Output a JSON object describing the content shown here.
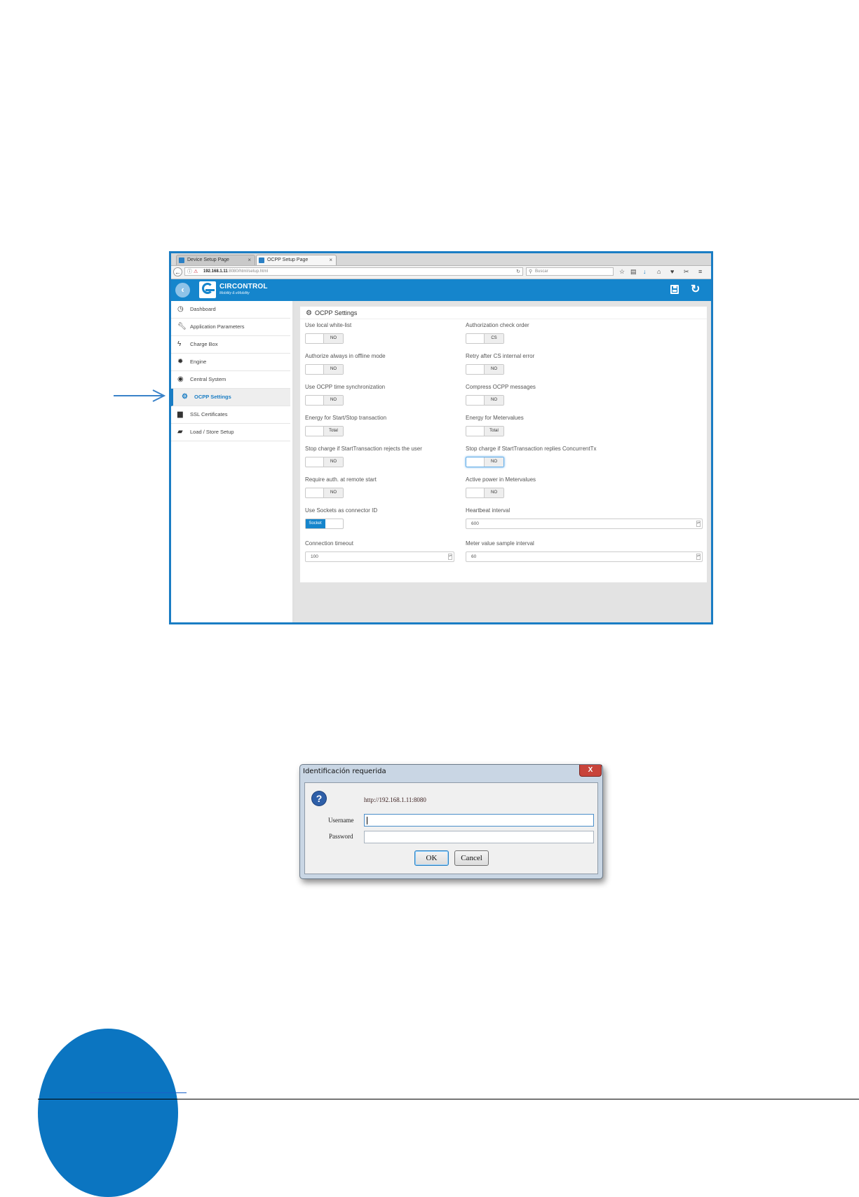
{
  "browser": {
    "tabs": [
      {
        "label": "Device Setup Page",
        "close": "×"
      },
      {
        "label": "OCPP Setup Page",
        "close": "×"
      }
    ],
    "url_host": "192.168.1.11",
    "url_rest": ":8080/html/setup.html",
    "search_placeholder": "Buscar",
    "toolbar_icons": [
      "star-icon",
      "reader-icon",
      "download-icon",
      "home-icon",
      "pocket-icon",
      "extension-icon",
      "menu-icon"
    ]
  },
  "app": {
    "brand": "CIRCONTROL",
    "tagline": "Mobility & eMobility",
    "accent_color": "#1585cc"
  },
  "sidebar": {
    "items": [
      {
        "label": "Dashboard",
        "icon": "dashboard-icon"
      },
      {
        "label": "Application Parameters",
        "icon": "wrench-icon"
      },
      {
        "label": "Charge Box",
        "icon": "bolt-icon"
      },
      {
        "label": "Engine",
        "icon": "engine-icon"
      },
      {
        "label": "Central System",
        "icon": "target-icon"
      },
      {
        "label": "OCPP Settings",
        "icon": "gear-icon",
        "active": true
      },
      {
        "label": "SSL Certificates",
        "icon": "lock-icon"
      },
      {
        "label": "Load / Store Setup",
        "icon": "folder-open-icon"
      }
    ]
  },
  "panel": {
    "title": "OCPP Settings",
    "fields": [
      {
        "label": "Use local white-list",
        "value": "NO"
      },
      {
        "label": "Authorization check order",
        "value": "CS"
      },
      {
        "label": "Authorize always in offline mode",
        "value": "NO"
      },
      {
        "label": "Retry after CS internal error",
        "value": "NO"
      },
      {
        "label": "Use OCPP time synchronization",
        "value": "NO"
      },
      {
        "label": "Compress OCPP messages",
        "value": "NO"
      },
      {
        "label": "Energy for Start/Stop transaction",
        "value": "Total"
      },
      {
        "label": "Energy for Metervalues",
        "value": "Total"
      },
      {
        "label": "Stop charge if StartTransaction rejects the user",
        "value": "NO"
      },
      {
        "label": "Stop charge if StartTransaction replies ConcurrentTx",
        "value": "NO"
      },
      {
        "label": "Require auth. at remote start",
        "value": "NO"
      },
      {
        "label": "Active power in Metervalues",
        "value": "NO"
      },
      {
        "label": "Use Sockets as connector ID",
        "value": "Socket"
      },
      {
        "label": "Heartbeat interval",
        "value": "600"
      },
      {
        "label": "Connection timeout",
        "value": "100"
      },
      {
        "label": "Meter value sample interval",
        "value": "60"
      }
    ]
  },
  "dialog": {
    "title": "Identificación requerida",
    "close": "X",
    "url": "http://192.168.1.11:8080",
    "username_label": "Username",
    "password_label": "Password",
    "username_value": "",
    "password_value": "",
    "ok_label": "OK",
    "cancel_label": "Cancel"
  }
}
